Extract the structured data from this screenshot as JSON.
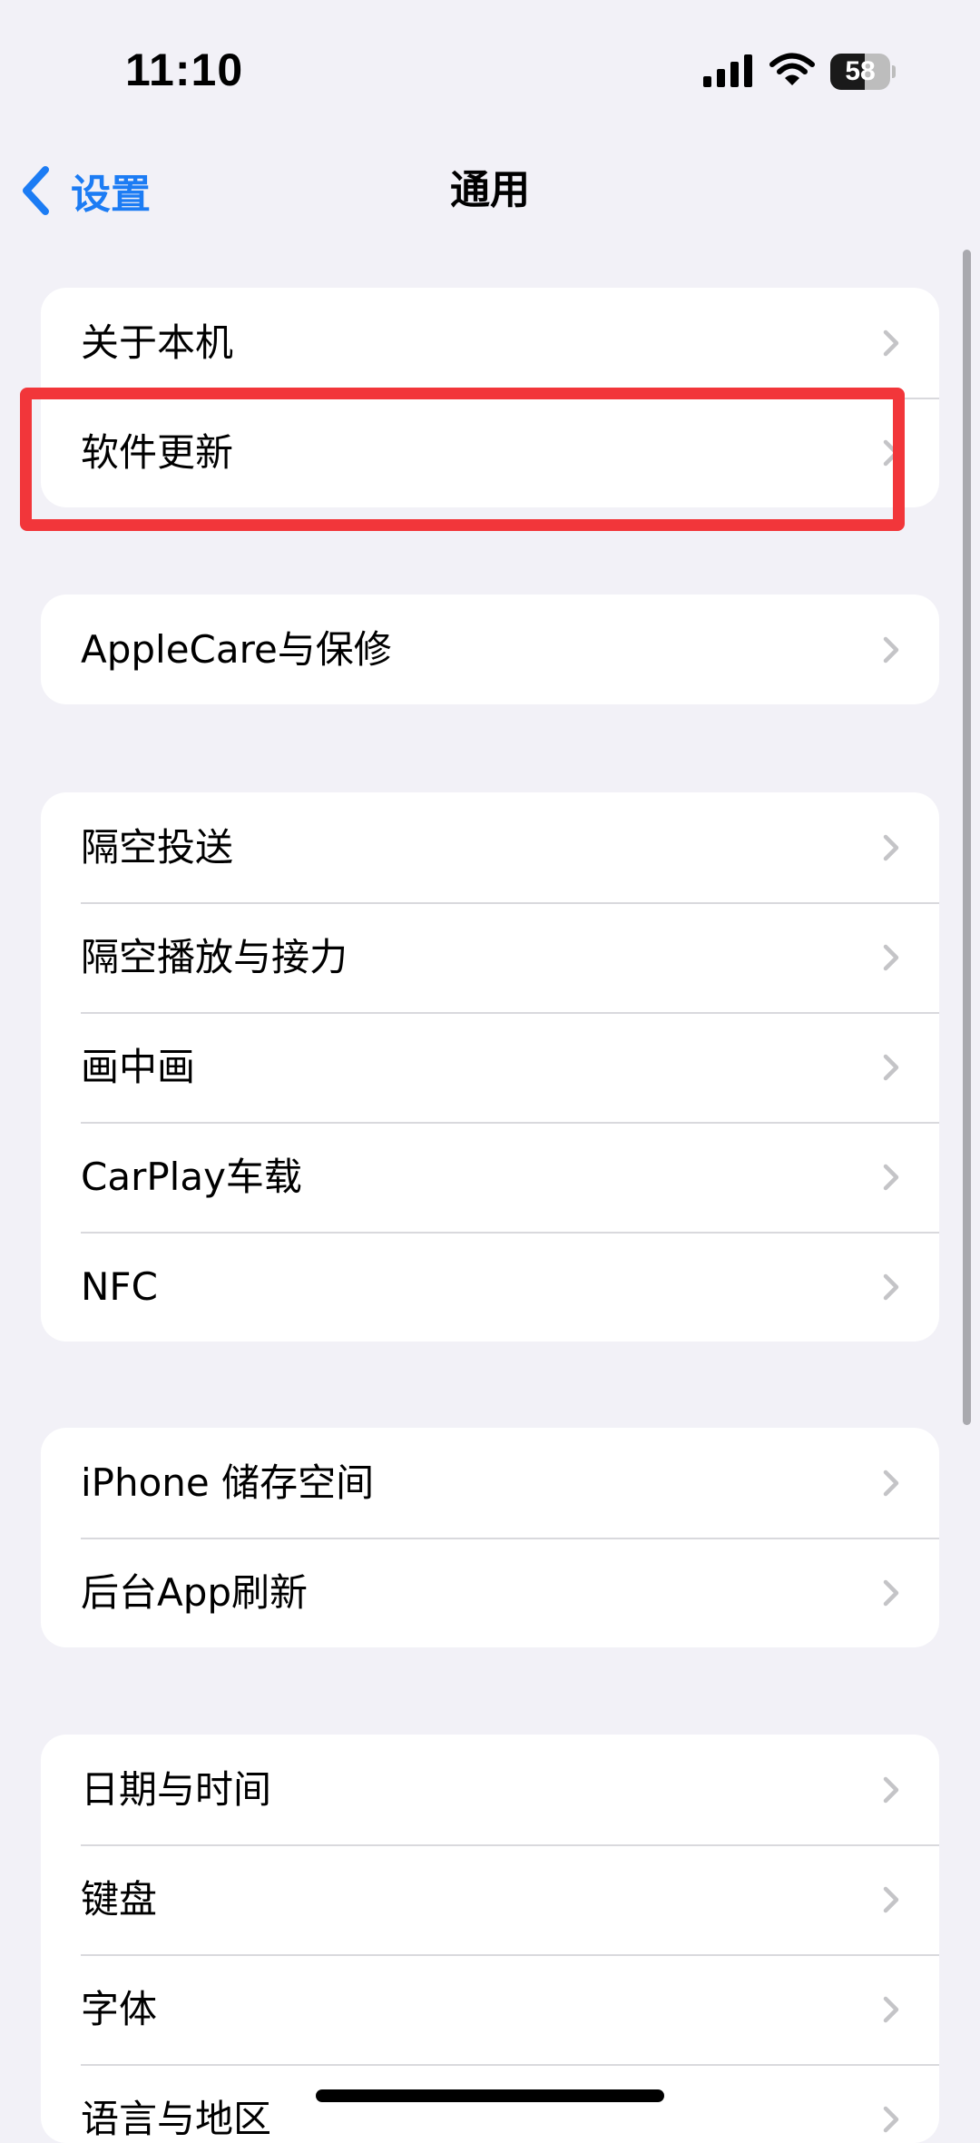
{
  "status_bar": {
    "time": "11:10",
    "battery_percent": "58",
    "battery_level": 0.58,
    "icons": [
      "signal-icon",
      "wifi-icon",
      "battery-icon"
    ]
  },
  "nav": {
    "back_label": "设置",
    "title": "通用"
  },
  "groups": [
    {
      "items": [
        {
          "label": "关于本机"
        },
        {
          "label": "软件更新"
        }
      ]
    },
    {
      "items": [
        {
          "label": "AppleCare与保修"
        }
      ]
    },
    {
      "items": [
        {
          "label": "隔空投送"
        },
        {
          "label": "隔空播放与接力"
        },
        {
          "label": "画中画"
        },
        {
          "label": "CarPlay车载"
        },
        {
          "label": "NFC"
        }
      ]
    },
    {
      "items": [
        {
          "label": "iPhone 储存空间"
        },
        {
          "label": "后台App刷新"
        }
      ]
    },
    {
      "items": [
        {
          "label": "日期与时间"
        },
        {
          "label": "键盘"
        },
        {
          "label": "字体"
        },
        {
          "label": "语言与地区"
        }
      ]
    }
  ],
  "colors": {
    "background": "#F2F1F7",
    "accent": "#1C7CF4",
    "highlight": "#F2363A",
    "chevron": "#C4C4C7",
    "separator": "#D9D9DD"
  }
}
